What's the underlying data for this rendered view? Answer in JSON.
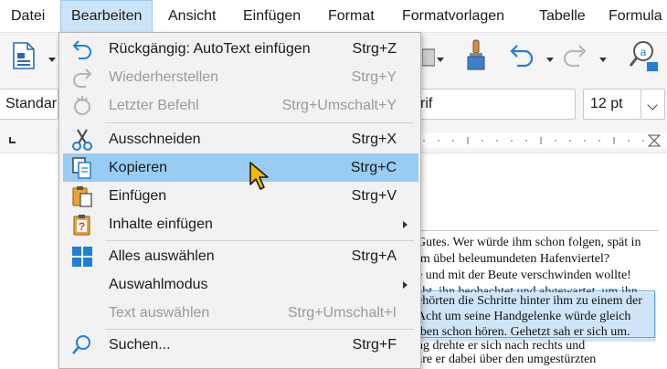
{
  "menubar": {
    "items": [
      "Datei",
      "Bearbeiten",
      "Ansicht",
      "Einfügen",
      "Format",
      "Formatvorlagen",
      "Tabelle",
      "Formula"
    ]
  },
  "formatbar": {
    "style_value": "Standar",
    "font_value": "rif",
    "size_value": "12 pt"
  },
  "edit_menu": {
    "items": [
      {
        "label": "Rückgängig: AutoText einfügen",
        "shortcut": "Strg+Z",
        "icon": "undo-icon"
      },
      {
        "label": "Wiederherstellen",
        "shortcut": "Strg+Y",
        "icon": "redo-icon"
      },
      {
        "label": "Letzter Befehl",
        "shortcut": "Strg+Umschalt+Y",
        "icon": "repeat-icon"
      },
      {
        "label": "Ausschneiden",
        "shortcut": "Strg+X",
        "icon": "scissors-icon"
      },
      {
        "label": "Kopieren",
        "shortcut": "Strg+C",
        "icon": "copy-icon"
      },
      {
        "label": "Einfügen",
        "shortcut": "Strg+V",
        "icon": "paste-icon"
      },
      {
        "label": "Inhalte einfügen",
        "shortcut": "",
        "icon": "paste-special-icon"
      },
      {
        "label": "Alles auswählen",
        "shortcut": "Strg+A",
        "icon": "select-all-icon"
      },
      {
        "label": "Auswahlmodus",
        "shortcut": "",
        "icon": ""
      },
      {
        "label": "Text auswählen",
        "shortcut": "Strg+Umschalt+I",
        "icon": ""
      },
      {
        "label": "Suchen...",
        "shortcut": "Strg+F",
        "icon": "search-icon"
      }
    ]
  },
  "document": {
    "lines": [
      "Gutes. Wer würde ihm schon folgen, spät in",
      "im übel beleumundeten Hafenviertel?",
      "e und mit der Beute verschwinden wollte!",
      "abt, ihn beobachtet und abgewartet, um ihn",
      "ehörten die Schritte hinter ihm zu einem der",
      "Acht um seine Handgelenke würde gleich",
      "iben schon hören. Gehetzt sah er sich um.",
      "ng drehte er sich nach rechts und",
      "äre er dabei über den umgestürzten"
    ]
  },
  "colors": {
    "highlight": "#99ccf3",
    "selection": "#cfe5f7",
    "accent": "#1e7fd4"
  }
}
